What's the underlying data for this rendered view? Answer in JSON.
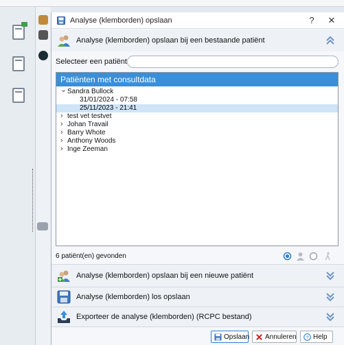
{
  "dialog": {
    "title": "Analyse (klemborden) opslaan",
    "help_button": "?",
    "close_button": "✕"
  },
  "existing_section": {
    "label": "Analyse (klemborden) opslaan bij een bestaande patiënt"
  },
  "select_patient": {
    "label": "Selecteer een patiënt:",
    "value": ""
  },
  "patient_panel": {
    "header": "Patiënten met consultdata",
    "patients": [
      {
        "name": "Sandra Bullock",
        "expanded": true,
        "entries": [
          "31/01/2024 - 07:58",
          "25/11/2023 - 21:41"
        ]
      },
      {
        "name": "test vet testvet",
        "expanded": false
      },
      {
        "name": "Johan Travail",
        "expanded": false
      },
      {
        "name": "Barry Whote",
        "expanded": false
      },
      {
        "name": "Anthony Woods",
        "expanded": false
      },
      {
        "name": "Inge Zeeman",
        "expanded": false
      }
    ],
    "selected_entry": "25/11/2023 - 21:41"
  },
  "status": {
    "count_text": "6 patiënt(en) gevonden"
  },
  "other_sections": {
    "new_patient": "Analyse (klemborden) opslaan bij een nieuwe patiënt",
    "standalone": "Analyse (klemborden) los opslaan",
    "export": "Exporteer de analyse (klemborden) (RCPC bestand)"
  },
  "footer": {
    "save": "Opslaan",
    "cancel": "Annuleren",
    "help": "Help"
  },
  "icons": {
    "title": "save-disk-icon",
    "existing": "users-icon",
    "new_patient": "add-users-icon",
    "standalone": "floppy-disk-icon",
    "export": "upload-tray-icon",
    "collapse": "double-chevron-up-icon",
    "expand": "double-chevron-down-icon"
  },
  "colors": {
    "accent": "#3a8fd8",
    "selection": "#cfe4f7",
    "chevron": "#6f93c4",
    "cancel_x": "#d22020"
  }
}
